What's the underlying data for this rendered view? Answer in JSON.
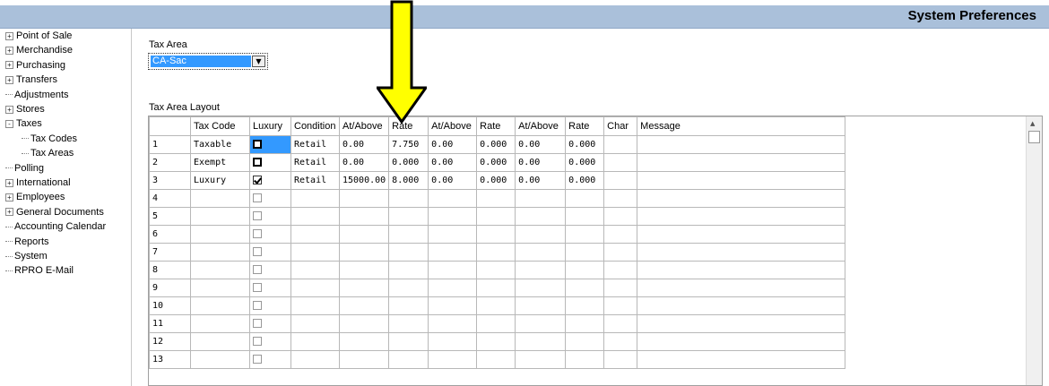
{
  "window": {
    "title": "System Preferences"
  },
  "tree": [
    {
      "label": "Point of Sale",
      "expander": "+",
      "level": 0
    },
    {
      "label": "Merchandise",
      "expander": "+",
      "level": 0
    },
    {
      "label": "Purchasing",
      "expander": "+",
      "level": 0
    },
    {
      "label": "Transfers",
      "expander": "+",
      "level": 0
    },
    {
      "label": "Adjustments",
      "expander": "",
      "level": 0
    },
    {
      "label": "Stores",
      "expander": "+",
      "level": 0
    },
    {
      "label": "Taxes",
      "expander": "-",
      "level": 0
    },
    {
      "label": "Tax Codes",
      "expander": "",
      "level": 1
    },
    {
      "label": "Tax Areas",
      "expander": "",
      "level": 1
    },
    {
      "label": "Polling",
      "expander": "",
      "level": 0
    },
    {
      "label": "International",
      "expander": "+",
      "level": 0
    },
    {
      "label": "Employees",
      "expander": "+",
      "level": 0
    },
    {
      "label": "General Documents",
      "expander": "+",
      "level": 0
    },
    {
      "label": "Accounting Calendar",
      "expander": "",
      "level": 0
    },
    {
      "label": "Reports",
      "expander": "",
      "level": 0
    },
    {
      "label": "System",
      "expander": "",
      "level": 0
    },
    {
      "label": "RPRO E-Mail",
      "expander": "",
      "level": 0
    }
  ],
  "tax_area": {
    "label": "Tax Area",
    "value": "CA-Sac"
  },
  "layout": {
    "label": "Tax Area Layout",
    "columns": [
      "",
      "Tax Code",
      "Luxury",
      "Condition",
      "At/Above",
      "Rate",
      "At/Above",
      "Rate",
      "At/Above",
      "Rate",
      "Char",
      "Message"
    ],
    "rows": [
      {
        "num": "1",
        "tax_code": "Taxable",
        "luxury": false,
        "condition": "Retail",
        "at1": "0.00",
        "rate1": "7.750",
        "at2": "0.00",
        "rate2": "0.000",
        "at3": "0.00",
        "rate3": "0.000",
        "char": "",
        "message": ""
      },
      {
        "num": "2",
        "tax_code": "Exempt",
        "luxury": false,
        "condition": "Retail",
        "at1": "0.00",
        "rate1": "0.000",
        "at2": "0.00",
        "rate2": "0.000",
        "at3": "0.00",
        "rate3": "0.000",
        "char": "",
        "message": ""
      },
      {
        "num": "3",
        "tax_code": "Luxury",
        "luxury": true,
        "condition": "Retail",
        "at1": "15000.00",
        "rate1": "8.000",
        "at2": "0.00",
        "rate2": "0.000",
        "at3": "0.00",
        "rate3": "0.000",
        "char": "",
        "message": ""
      },
      {
        "num": "4",
        "tax_code": "",
        "luxury": false,
        "condition": "",
        "at1": "",
        "rate1": "",
        "at2": "",
        "rate2": "",
        "at3": "",
        "rate3": "",
        "char": "",
        "message": ""
      },
      {
        "num": "5",
        "tax_code": "",
        "luxury": false,
        "condition": "",
        "at1": "",
        "rate1": "",
        "at2": "",
        "rate2": "",
        "at3": "",
        "rate3": "",
        "char": "",
        "message": ""
      },
      {
        "num": "6",
        "tax_code": "",
        "luxury": false,
        "condition": "",
        "at1": "",
        "rate1": "",
        "at2": "",
        "rate2": "",
        "at3": "",
        "rate3": "",
        "char": "",
        "message": ""
      },
      {
        "num": "7",
        "tax_code": "",
        "luxury": false,
        "condition": "",
        "at1": "",
        "rate1": "",
        "at2": "",
        "rate2": "",
        "at3": "",
        "rate3": "",
        "char": "",
        "message": ""
      },
      {
        "num": "8",
        "tax_code": "",
        "luxury": false,
        "condition": "",
        "at1": "",
        "rate1": "",
        "at2": "",
        "rate2": "",
        "at3": "",
        "rate3": "",
        "char": "",
        "message": ""
      },
      {
        "num": "9",
        "tax_code": "",
        "luxury": false,
        "condition": "",
        "at1": "",
        "rate1": "",
        "at2": "",
        "rate2": "",
        "at3": "",
        "rate3": "",
        "char": "",
        "message": ""
      },
      {
        "num": "10",
        "tax_code": "",
        "luxury": false,
        "condition": "",
        "at1": "",
        "rate1": "",
        "at2": "",
        "rate2": "",
        "at3": "",
        "rate3": "",
        "char": "",
        "message": ""
      },
      {
        "num": "11",
        "tax_code": "",
        "luxury": false,
        "condition": "",
        "at1": "",
        "rate1": "",
        "at2": "",
        "rate2": "",
        "at3": "",
        "rate3": "",
        "char": "",
        "message": ""
      },
      {
        "num": "12",
        "tax_code": "",
        "luxury": false,
        "condition": "",
        "at1": "",
        "rate1": "",
        "at2": "",
        "rate2": "",
        "at3": "",
        "rate3": "",
        "char": "",
        "message": ""
      },
      {
        "num": "13",
        "tax_code": "",
        "luxury": false,
        "condition": "",
        "at1": "",
        "rate1": "",
        "at2": "",
        "rate2": "",
        "at3": "",
        "rate3": "",
        "char": "",
        "message": ""
      }
    ]
  },
  "colors": {
    "titlebar": "#aac0da",
    "selection": "#3399ff",
    "arrow_fill": "#ffff00"
  },
  "icons": {
    "arrow": "down-arrow-icon",
    "combo": "chevron-down-icon",
    "scroll": "scroll-up-icon"
  }
}
